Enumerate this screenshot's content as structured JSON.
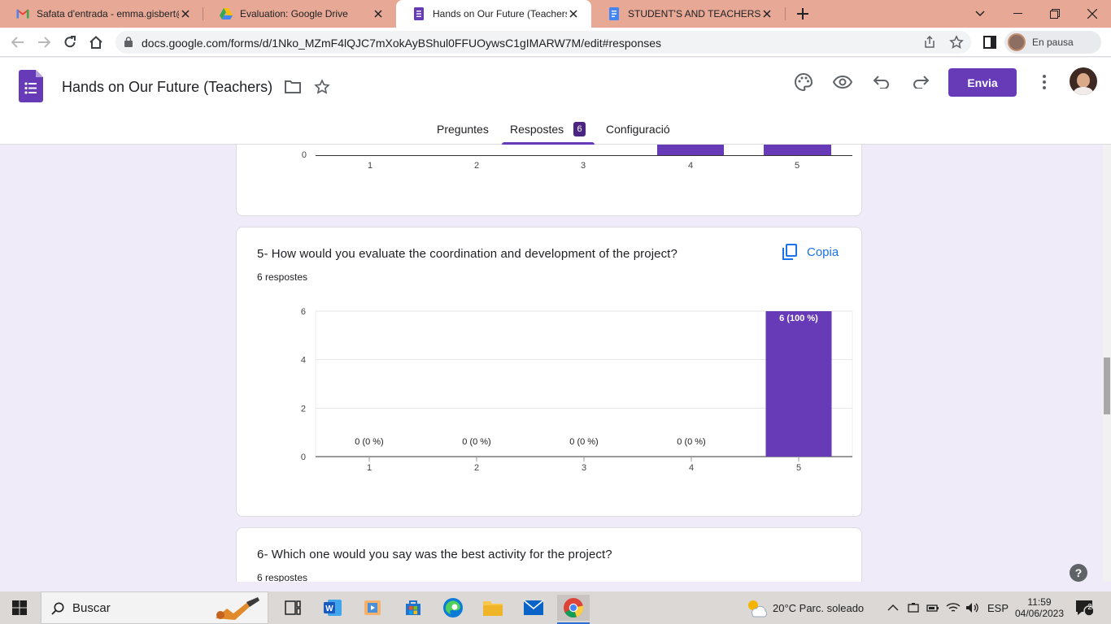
{
  "browser": {
    "tabs": [
      {
        "label": "Safata d'entrada - emma.gisbert@",
        "icon": "gmail-icon"
      },
      {
        "label": "Evaluation: Google Drive",
        "icon": "drive-icon"
      },
      {
        "label": "Hands on Our Future (Teachers) -",
        "icon": "forms-icon",
        "active": true
      },
      {
        "label": "STUDENT'S AND TEACHERS' EVA",
        "icon": "docs-icon"
      }
    ],
    "url": "docs.google.com/forms/d/1Nko_MZmF4lQJC7mXokAyBShul0FFUOywsC1gIMARW7M/edit#responses",
    "profile_status": "En pausa"
  },
  "form": {
    "title": "Hands on Our Future (Teachers)",
    "send_label": "Envia",
    "tabs": {
      "questions": "Preguntes",
      "responses": "Respostes",
      "settings": "Configuració"
    },
    "response_count": "6"
  },
  "previous_chart": {
    "xticks": [
      "1",
      "2",
      "3",
      "4",
      "5"
    ],
    "y_zero": "0"
  },
  "question5": {
    "title": "5- How would you evaluate the coordination and development of the project?",
    "count": "6 respostes",
    "copy_label": "Copia"
  },
  "question6": {
    "title": "6- Which one would you say was the best activity for the project?",
    "count": "6 respostes"
  },
  "chart_data": {
    "type": "bar",
    "categories": [
      "1",
      "2",
      "3",
      "4",
      "5"
    ],
    "values": [
      0,
      0,
      0,
      0,
      6
    ],
    "data_labels": [
      "0 (0 %)",
      "0 (0 %)",
      "0 (0 %)",
      "0 (0 %)",
      "6 (100 %)"
    ],
    "yticks": [
      "0",
      "2",
      "4",
      "6"
    ],
    "ylim": [
      0,
      6
    ],
    "color": "#673ab7",
    "grid": true
  },
  "taskbar": {
    "search_placeholder": "Buscar",
    "weather": "20°C  Parc. soleado",
    "language": "ESP",
    "time": "11:59",
    "date": "04/06/2023",
    "notifications": "2"
  },
  "help_label": "?"
}
